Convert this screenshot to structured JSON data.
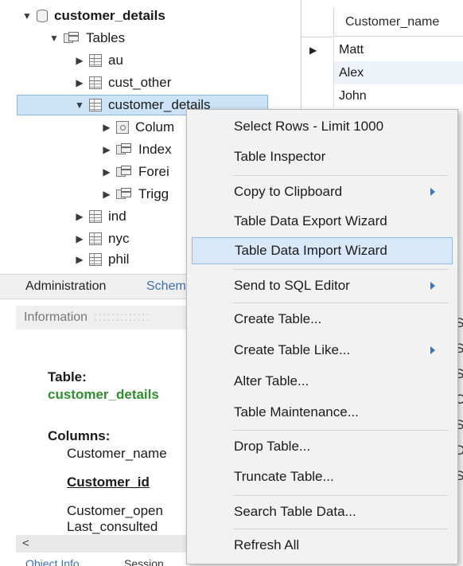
{
  "tree": {
    "schema": "customer_details",
    "tables_label": "Tables",
    "items": [
      "au",
      "cust_other",
      "customer_details"
    ],
    "sub_items": [
      "Colum",
      "Index",
      "Forei",
      "Trigg"
    ],
    "more_items": [
      "ind",
      "nyc",
      "phil"
    ]
  },
  "grid": {
    "column_header": "Customer_name",
    "rows": [
      "Matt",
      "Alex",
      "John"
    ]
  },
  "side_tabs": {
    "administration": "Administration",
    "schemas": "Schem"
  },
  "info": {
    "header": "Information",
    "table_label": "Table:",
    "table_name": "customer_details",
    "columns_label": "Columns:",
    "col_1": "Customer_name",
    "col_2": "Customer_id",
    "col_3": "Customer_open",
    "col_4": "Last_consulted",
    "scroll_left": "<",
    "bottom_tab_1": "Object Info",
    "bottom_tab_2": "Session"
  },
  "menu": {
    "items": [
      "Select Rows - Limit 1000",
      "Table Inspector",
      "Copy to Clipboard",
      "Table Data Export Wizard",
      "Table Data Import Wizard",
      "Send to SQL Editor",
      "Create Table...",
      "Create Table Like...",
      "Alter Table...",
      "Table Maintenance...",
      "Drop Table...",
      "Truncate Table...",
      "Search Table Data...",
      "Refresh All"
    ],
    "highlighted": "Table Data Import Wizard"
  },
  "edge_fragments": [
    "S",
    "S",
    "S",
    "C",
    "S",
    "D",
    "S"
  ],
  "colors": {
    "accent": "#2a79c9",
    "highlight": "#d9e8f8",
    "table_name_green": "#2f8f2f"
  }
}
